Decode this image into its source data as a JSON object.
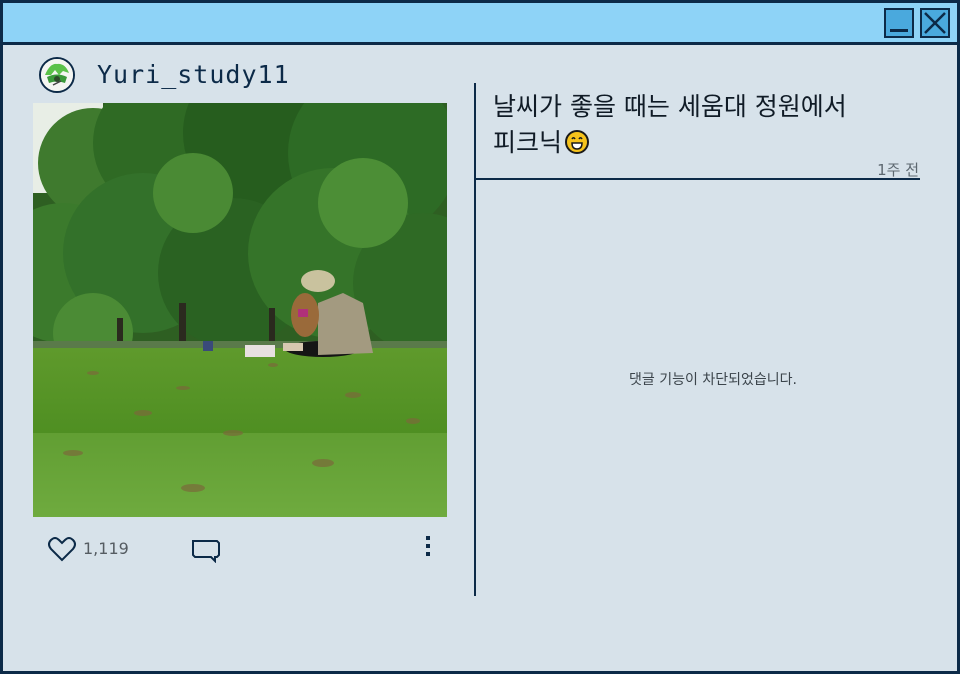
{
  "window": {
    "minimize_icon": "minimize-icon",
    "close_icon": "close-icon",
    "titlebar_color": "#8ed3f7",
    "border_color": "#0c2a48",
    "background_color": "#d7e2ea"
  },
  "post": {
    "username": "Yuri_study11",
    "caption_line1": "날씨가 좋을 때는 세움대 정원에서",
    "caption_line2": "피크닉",
    "caption_emoji": "smiling-face-emoji",
    "timestamp": "1주 전",
    "photo_icon": "park-photo",
    "likes": "1,119",
    "like_icon": "heart-icon",
    "comment_icon": "comment-icon",
    "more_icon": "more-options-icon",
    "comments_disabled_text": "댓글 기능이 차단되었습니다."
  }
}
